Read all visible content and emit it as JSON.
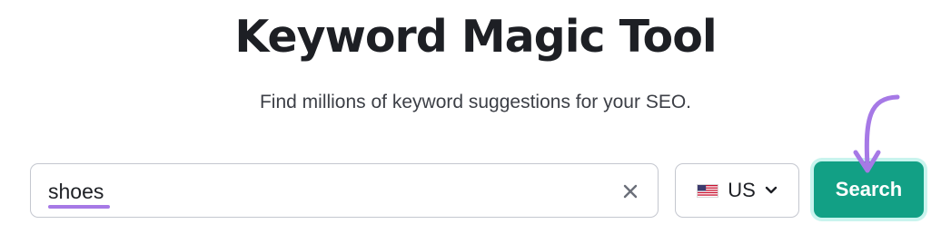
{
  "header": {
    "title": "Keyword Magic Tool",
    "subtitle": "Find millions of keyword suggestions for your SEO."
  },
  "search": {
    "value": "shoes",
    "clear_icon": "close-icon"
  },
  "database": {
    "selected": "US",
    "flag_icon": "us-flag-icon",
    "chevron_icon": "chevron-down-icon"
  },
  "actions": {
    "search_label": "Search"
  },
  "annotation": {
    "arrow_icon": "curved-arrow-icon",
    "highlight_color": "#a679e6"
  },
  "colors": {
    "button": "#12a085",
    "button_glow": "#c9f4ee",
    "text": "#1d1f24"
  }
}
